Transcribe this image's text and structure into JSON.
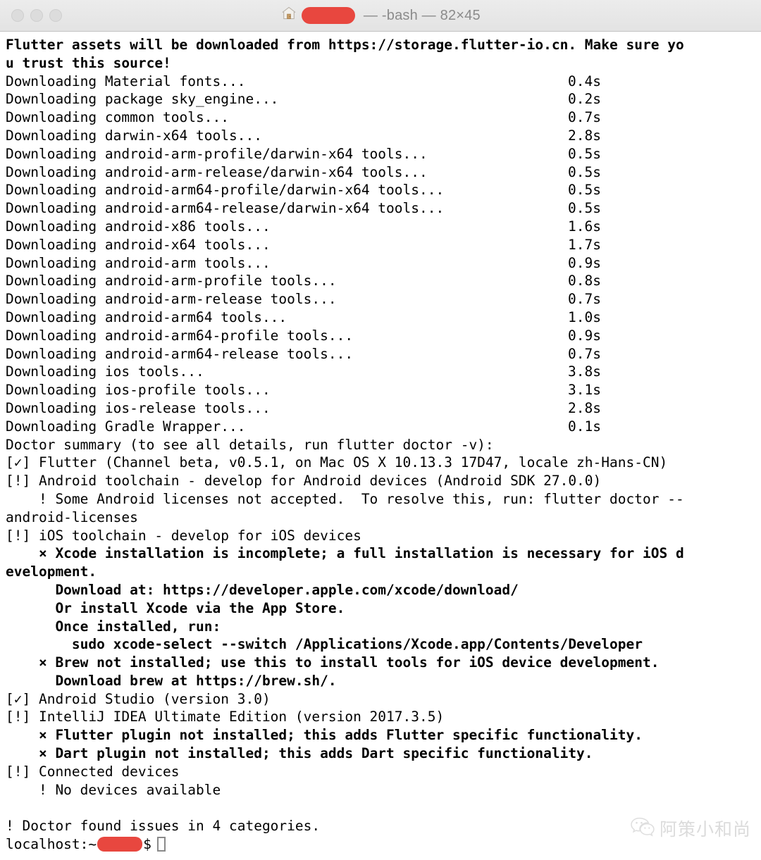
{
  "window": {
    "titlebar": {
      "traffic_lights": [
        "close",
        "minimize",
        "zoom"
      ],
      "home_icon": "home-folder-icon",
      "redacted_user": "",
      "title_text": " — -bash — 82×45",
      "shell": "-bash",
      "size": "82×45"
    }
  },
  "terminal": {
    "columns": 82,
    "rows": 45,
    "header": [
      "Flutter assets will be downloaded from https://storage.flutter-io.cn. Make sure yo",
      "u trust this source!"
    ],
    "downloads": [
      {
        "label": "Downloading Material fonts...",
        "time": "0.4s"
      },
      {
        "label": "Downloading package sky_engine...",
        "time": "0.2s"
      },
      {
        "label": "Downloading common tools...",
        "time": "0.7s"
      },
      {
        "label": "Downloading darwin-x64 tools...",
        "time": "2.8s"
      },
      {
        "label": "Downloading android-arm-profile/darwin-x64 tools...",
        "time": "0.5s"
      },
      {
        "label": "Downloading android-arm-release/darwin-x64 tools...",
        "time": "0.5s"
      },
      {
        "label": "Downloading android-arm64-profile/darwin-x64 tools...",
        "time": "0.5s"
      },
      {
        "label": "Downloading android-arm64-release/darwin-x64 tools...",
        "time": "0.5s"
      },
      {
        "label": "Downloading android-x86 tools...",
        "time": "1.6s"
      },
      {
        "label": "Downloading android-x64 tools...",
        "time": "1.7s"
      },
      {
        "label": "Downloading android-arm tools...",
        "time": "0.9s"
      },
      {
        "label": "Downloading android-arm-profile tools...",
        "time": "0.8s"
      },
      {
        "label": "Downloading android-arm-release tools...",
        "time": "0.7s"
      },
      {
        "label": "Downloading android-arm64 tools...",
        "time": "1.0s"
      },
      {
        "label": "Downloading android-arm64-profile tools...",
        "time": "0.9s"
      },
      {
        "label": "Downloading android-arm64-release tools...",
        "time": "0.7s"
      },
      {
        "label": "Downloading ios tools...",
        "time": "3.8s"
      },
      {
        "label": "Downloading ios-profile tools...",
        "time": "3.1s"
      },
      {
        "label": "Downloading ios-release tools...",
        "time": "2.8s"
      },
      {
        "label": "Downloading Gradle Wrapper...",
        "time": "0.1s"
      }
    ],
    "doctor": {
      "summary_line": "Doctor summary (to see all details, run flutter doctor -v):",
      "lines": [
        {
          "text": "[✓] Flutter (Channel beta, v0.5.1, on Mac OS X 10.13.3 17D47, locale zh-Hans-CN)",
          "bold": false
        },
        {
          "text": "[!] Android toolchain - develop for Android devices (Android SDK 27.0.0)",
          "bold": false
        },
        {
          "text": "    ! Some Android licenses not accepted.  To resolve this, run: flutter doctor --",
          "bold": false
        },
        {
          "text": "android-licenses",
          "bold": false
        },
        {
          "text": "[!] iOS toolchain - develop for iOS devices",
          "bold": false
        },
        {
          "text": "    × Xcode installation is incomplete; a full installation is necessary for iOS d",
          "bold": true
        },
        {
          "text": "evelopment.",
          "bold": true
        },
        {
          "text": "      Download at: https://developer.apple.com/xcode/download/",
          "bold": true
        },
        {
          "text": "      Or install Xcode via the App Store.",
          "bold": true
        },
        {
          "text": "      Once installed, run:",
          "bold": true
        },
        {
          "text": "        sudo xcode-select --switch /Applications/Xcode.app/Contents/Developer",
          "bold": true
        },
        {
          "text": "    × Brew not installed; use this to install tools for iOS device development.",
          "bold": true
        },
        {
          "text": "      Download brew at https://brew.sh/.",
          "bold": true
        },
        {
          "text": "[✓] Android Studio (version 3.0)",
          "bold": false
        },
        {
          "text": "[!] IntelliJ IDEA Ultimate Edition (version 2017.3.5)",
          "bold": false
        },
        {
          "text": "    × Flutter plugin not installed; this adds Flutter specific functionality.",
          "bold": true
        },
        {
          "text": "    × Dart plugin not installed; this adds Dart specific functionality.",
          "bold": true
        },
        {
          "text": "[!] Connected devices",
          "bold": false
        },
        {
          "text": "    ! No devices available",
          "bold": false
        },
        {
          "text": "",
          "bold": false
        },
        {
          "text": "! Doctor found issues in 4 categories.",
          "bold": false
        }
      ]
    },
    "prompt": {
      "host": "localhost:~",
      "redacted_user": "",
      "symbol": "$",
      "cursor": "block-outline"
    }
  },
  "watermark": {
    "icon": "wechat-icon",
    "text": "阿策小和尚"
  },
  "colors": {
    "redaction_red": "#e8473f",
    "terminal_fg": "#000000",
    "terminal_bg": "#ffffff",
    "titlebar_bg": "#e8e8e8",
    "title_fg": "#8b8b8b",
    "watermark_fg": "#d9d9d9"
  }
}
